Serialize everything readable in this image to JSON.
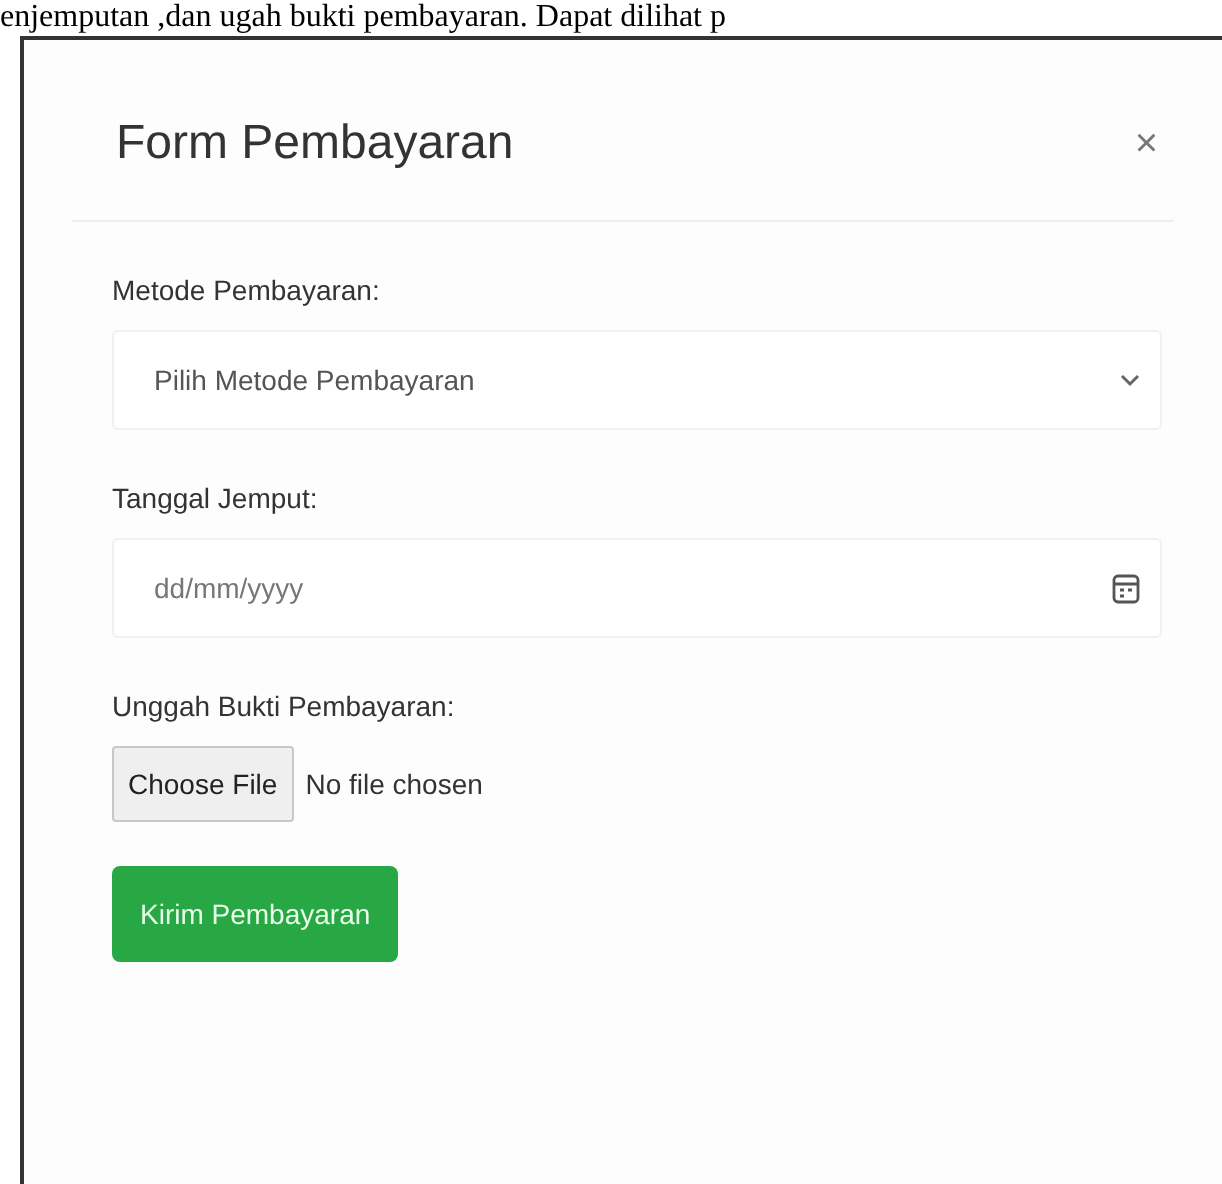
{
  "document_text": "enjemputan ,dan ugah bukti pembayaran. Dapat dilihat p",
  "modal": {
    "title": "Form Pembayaran",
    "close": "×"
  },
  "fields": [
    {
      "kind": "select",
      "label": "Metode Pembayaran:",
      "value": "Pilih Metode Pembayaran"
    },
    {
      "kind": "date",
      "label": "Tanggal Jemput:",
      "placeholder": "dd/mm/yyyy"
    },
    {
      "kind": "file",
      "label": "Unggah Bukti Pembayaran:",
      "button": "Choose File",
      "status": "No file chosen"
    }
  ],
  "submit": "Kirim Pembayaran"
}
